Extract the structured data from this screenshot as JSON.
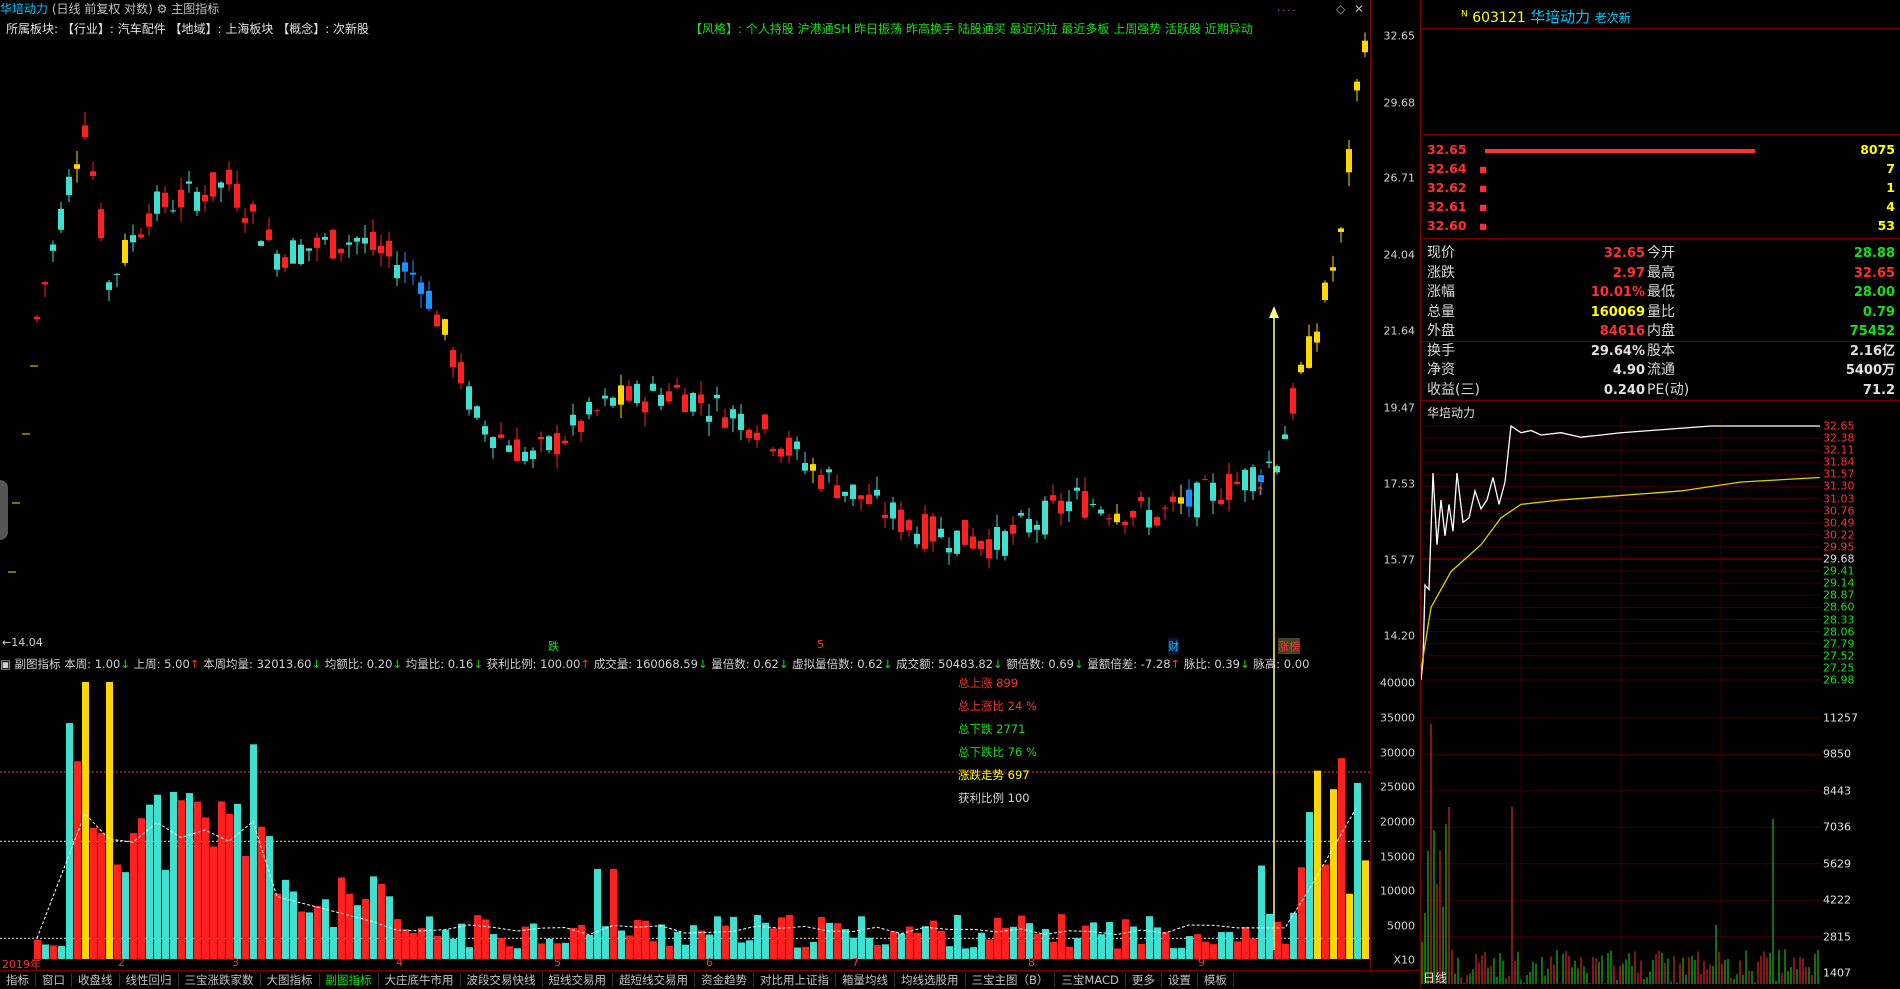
{
  "header": {
    "title": "华培动力",
    "period": "(日线 前复权 对数)",
    "menu": "主图指标",
    "sector_line": "所属板块: 【行业】: 汽车配件 【地域】: 上海板块 【概念】: 次新股",
    "style_tags": "【风格】: 个人持股 沪港通SH 昨日振荡 昨高换手 陆股通买 最近闪拉 最近多板 上周强势 活跃股 近期异动",
    "low_marker": "←14.04"
  },
  "main_yaxis": [
    "32.65",
    "29.68",
    "26.71",
    "24.04",
    "21.64",
    "19.47",
    "17.53",
    "15.77",
    "14.20"
  ],
  "event_labels": [
    {
      "text": "跌",
      "color": "#18e018"
    },
    {
      "text": "5",
      "color": "#ff3030"
    },
    {
      "text": "财",
      "color": "#00c8ff"
    },
    {
      "text": "涨榜",
      "color": "#ff3030"
    }
  ],
  "sub_header": {
    "name": "副图指标",
    "items": [
      {
        "label": "本周:",
        "value": "1.00",
        "dir": "down"
      },
      {
        "label": "上周:",
        "value": "5.00",
        "dir": "up"
      },
      {
        "label": "本周均量:",
        "value": "32013.60",
        "dir": "down"
      },
      {
        "label": "均额比:",
        "value": "0.20",
        "dir": "down"
      },
      {
        "label": "均量比:",
        "value": "0.16",
        "dir": "down"
      },
      {
        "label": "获利比例:",
        "value": "100.00",
        "dir": "up"
      },
      {
        "label": "成交量:",
        "value": "160068.59",
        "dir": "down"
      },
      {
        "label": "量倍数:",
        "value": "0.62",
        "dir": "down"
      },
      {
        "label": "虚拟量倍数:",
        "value": "0.62",
        "dir": "down"
      },
      {
        "label": "成交额:",
        "value": "50483.82",
        "dir": "down"
      },
      {
        "label": "额倍数:",
        "value": "0.69",
        "dir": "down"
      },
      {
        "label": "量额倍差:",
        "value": "-7.28",
        "dir": "up"
      },
      {
        "label": "脉比:",
        "value": "0.39",
        "dir": "down"
      },
      {
        "label": "脉高:",
        "value": "0.00",
        "dir": ""
      }
    ]
  },
  "sub_stats": [
    {
      "text": "总上涨 899",
      "color": "#ff3030"
    },
    {
      "text": "总上涨比 24 %",
      "color": "#ff3030"
    },
    {
      "text": "总下跌 2771",
      "color": "#18e018"
    },
    {
      "text": "总下跌比 76 %",
      "color": "#18e018"
    },
    {
      "text": "涨跌走势 697",
      "color": "#ffff00"
    },
    {
      "text": "获利比例 100",
      "color": "#d0d0d0"
    }
  ],
  "sub_yaxis": [
    "40000",
    "35000",
    "30000",
    "25000",
    "20000",
    "15000",
    "10000",
    "5000",
    "X10"
  ],
  "months": [
    "2019年",
    "2",
    "3",
    "4",
    "5",
    "6",
    "7",
    "8",
    "9"
  ],
  "bottom_tabs": [
    "指标",
    "窗口",
    "收盘线",
    "线性回归",
    "三宝涨跌家数",
    "大图指标",
    "副图指标",
    "大庄底牛市用",
    "波段交易快线",
    "短线交易用",
    "超短线交易用",
    "资金趋势",
    "对比用上证指",
    "箱量均线",
    "均线选股用",
    "三宝主图（B）",
    "三宝MACD",
    "更多",
    "设置",
    "模板"
  ],
  "right_panel": {
    "code": "603121",
    "name": "华培动力",
    "tag": "老次新",
    "order_book": [
      {
        "price": "32.65",
        "vol": "8075",
        "bar": true
      },
      {
        "price": "32.64",
        "vol": "7"
      },
      {
        "price": "32.62",
        "vol": "1"
      },
      {
        "price": "32.61",
        "vol": "4"
      },
      {
        "price": "32.60",
        "vol": "53"
      }
    ],
    "quotes": [
      {
        "l1": "现价",
        "v1": "32.65",
        "c1": "red",
        "l2": "今开",
        "v2": "28.88",
        "c2": "grn"
      },
      {
        "l1": "涨跌",
        "v1": "2.97",
        "c1": "red",
        "l2": "最高",
        "v2": "32.65",
        "c2": "red"
      },
      {
        "l1": "涨幅",
        "v1": "10.01%",
        "c1": "red",
        "l2": "最低",
        "v2": "28.00",
        "c2": "grn"
      },
      {
        "l1": "总量",
        "v1": "160069",
        "c1": "yel",
        "l2": "量比",
        "v2": "0.79",
        "c2": "grn"
      },
      {
        "l1": "外盘",
        "v1": "84616",
        "c1": "red",
        "l2": "内盘",
        "v2": "75452",
        "c2": "grn"
      },
      {
        "l1": "换手",
        "v1": "29.64%",
        "c1": "wht",
        "l2": "股本",
        "v2": "2.16亿",
        "c2": "wht"
      },
      {
        "l1": "净资",
        "v1": "4.90",
        "c1": "wht",
        "l2": "流通",
        "v2": "5400万",
        "c2": "wht"
      },
      {
        "l1": "收益(三)",
        "v1": "0.240",
        "c1": "wht",
        "l2": "PE(动)",
        "v2": "71.2",
        "c2": "wht"
      }
    ],
    "intraday_title": "华培动力",
    "intraday_prices": [
      "32.65",
      "32.38",
      "32.11",
      "31.84",
      "31.57",
      "31.30",
      "31.03",
      "30.76",
      "30.49",
      "30.22",
      "29.95",
      "29.68",
      "29.41",
      "29.14",
      "28.87",
      "28.60",
      "28.33",
      "28.06",
      "27.79",
      "27.52",
      "27.25",
      "26.98"
    ],
    "intraday_vols": [
      "11257",
      "9850",
      "8443",
      "7036",
      "5629",
      "4222",
      "2815",
      "1407"
    ],
    "bottom_label": "日线"
  }
}
